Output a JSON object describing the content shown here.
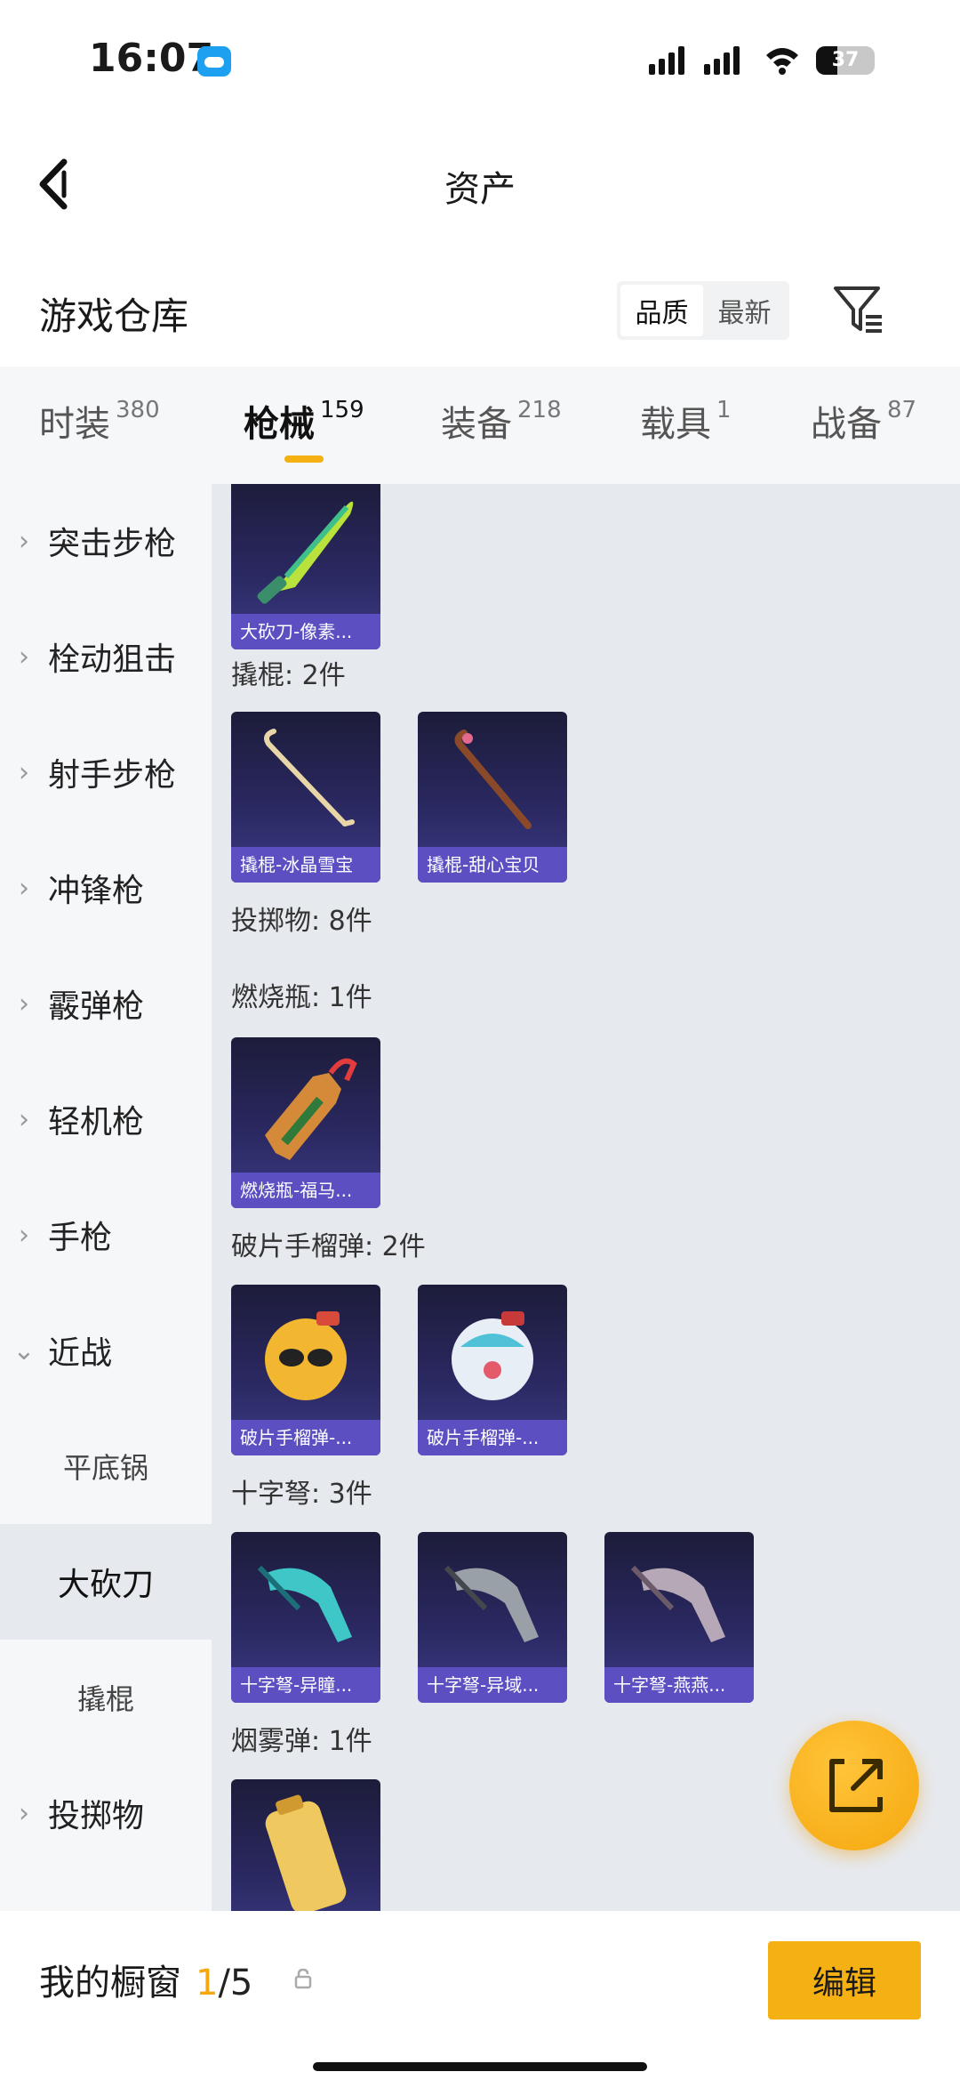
{
  "status_bar": {
    "time": "16:07",
    "battery": "37"
  },
  "header": {
    "title": "资产"
  },
  "warehouse": {
    "title": "游戏仓库",
    "sort_options": [
      {
        "label": "品质",
        "active": true
      },
      {
        "label": "最新",
        "active": false
      }
    ]
  },
  "tabs": [
    {
      "label": "时装",
      "count": "380"
    },
    {
      "label": "枪械",
      "count": "159",
      "active": true
    },
    {
      "label": "装备",
      "count": "218"
    },
    {
      "label": "载具",
      "count": "1"
    },
    {
      "label": "战备",
      "count": "87"
    }
  ],
  "sidebar": {
    "items": [
      {
        "label": "突击步枪",
        "chevron": "›"
      },
      {
        "label": "栓动狙击",
        "chevron": "›"
      },
      {
        "label": "射手步枪",
        "chevron": "›"
      },
      {
        "label": "冲锋枪",
        "chevron": "›"
      },
      {
        "label": "霰弹枪",
        "chevron": "›"
      },
      {
        "label": "轻机枪",
        "chevron": "›"
      },
      {
        "label": "手枪",
        "chevron": "›"
      },
      {
        "label": "近战",
        "chevron": "⌄"
      },
      {
        "label": "平底锅"
      },
      {
        "label": "大砍刀"
      },
      {
        "label": "撬棍"
      },
      {
        "label": "投掷物",
        "chevron": "›"
      }
    ]
  },
  "content": {
    "groups": [
      {
        "label": "撬棍: 2件"
      },
      {
        "label": "投掷物: 8件"
      },
      {
        "label": "燃烧瓶: 1件"
      },
      {
        "label": "破片手榴弹: 2件"
      },
      {
        "label": "十字弩: 3件"
      },
      {
        "label": "烟雾弹: 1件"
      }
    ],
    "cards": [
      {
        "caption": "大砍刀-像素...",
        "icon": "machete-icon"
      },
      {
        "caption": "撬棍-冰晶雪宝",
        "icon": "crowbar-icon"
      },
      {
        "caption": "撬棍-甜心宝贝",
        "icon": "crowbar-icon"
      },
      {
        "caption": "燃烧瓶-福马...",
        "icon": "molotov-icon"
      },
      {
        "caption": "破片手榴弹-...",
        "icon": "grenade-icon"
      },
      {
        "caption": "破片手榴弹-...",
        "icon": "grenade-icon"
      },
      {
        "caption": "十字弩-异瞳...",
        "icon": "crossbow-icon"
      },
      {
        "caption": "十字弩-异域...",
        "icon": "crossbow-icon"
      },
      {
        "caption": "十字弩-燕燕...",
        "icon": "crossbow-icon"
      },
      {
        "caption": "",
        "icon": "smoke-grenade-icon"
      }
    ]
  },
  "bottom_bar": {
    "showcase_label": "我的橱窗",
    "showcase_current": "1",
    "showcase_total": "/5",
    "edit_label": "编辑"
  },
  "colors": {
    "accent": "#f5b014",
    "card_caption": "#5b4fc2",
    "content_bg": "#e6e9ee"
  }
}
